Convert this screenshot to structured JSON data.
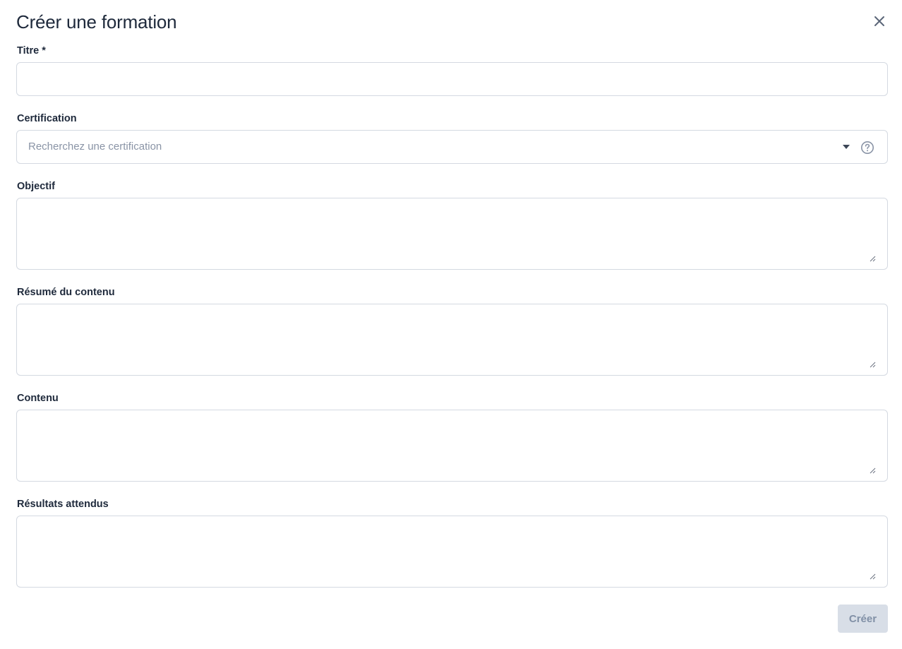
{
  "dialog": {
    "title": "Créer une formation",
    "close_icon": "close-icon"
  },
  "fields": {
    "titre": {
      "label": "Titre *",
      "value": ""
    },
    "certification": {
      "label": "Certification",
      "placeholder": "Recherchez une certification",
      "dropdown_icon": "caret-down-icon",
      "help_icon": "question-circle-icon"
    },
    "objectif": {
      "label": "Objectif",
      "value": ""
    },
    "resume": {
      "label": "Résumé du contenu",
      "value": ""
    },
    "contenu": {
      "label": "Contenu",
      "value": ""
    },
    "resultats": {
      "label": "Résultats attendus",
      "value": ""
    }
  },
  "actions": {
    "submit_label": "Créer",
    "submit_state": "disabled"
  },
  "colors": {
    "text": "#1e293b",
    "border": "#d4d9e1",
    "placeholder": "#8a94a6",
    "button_bg_disabled": "#d8dee7",
    "button_text_disabled": "#8190a6"
  }
}
